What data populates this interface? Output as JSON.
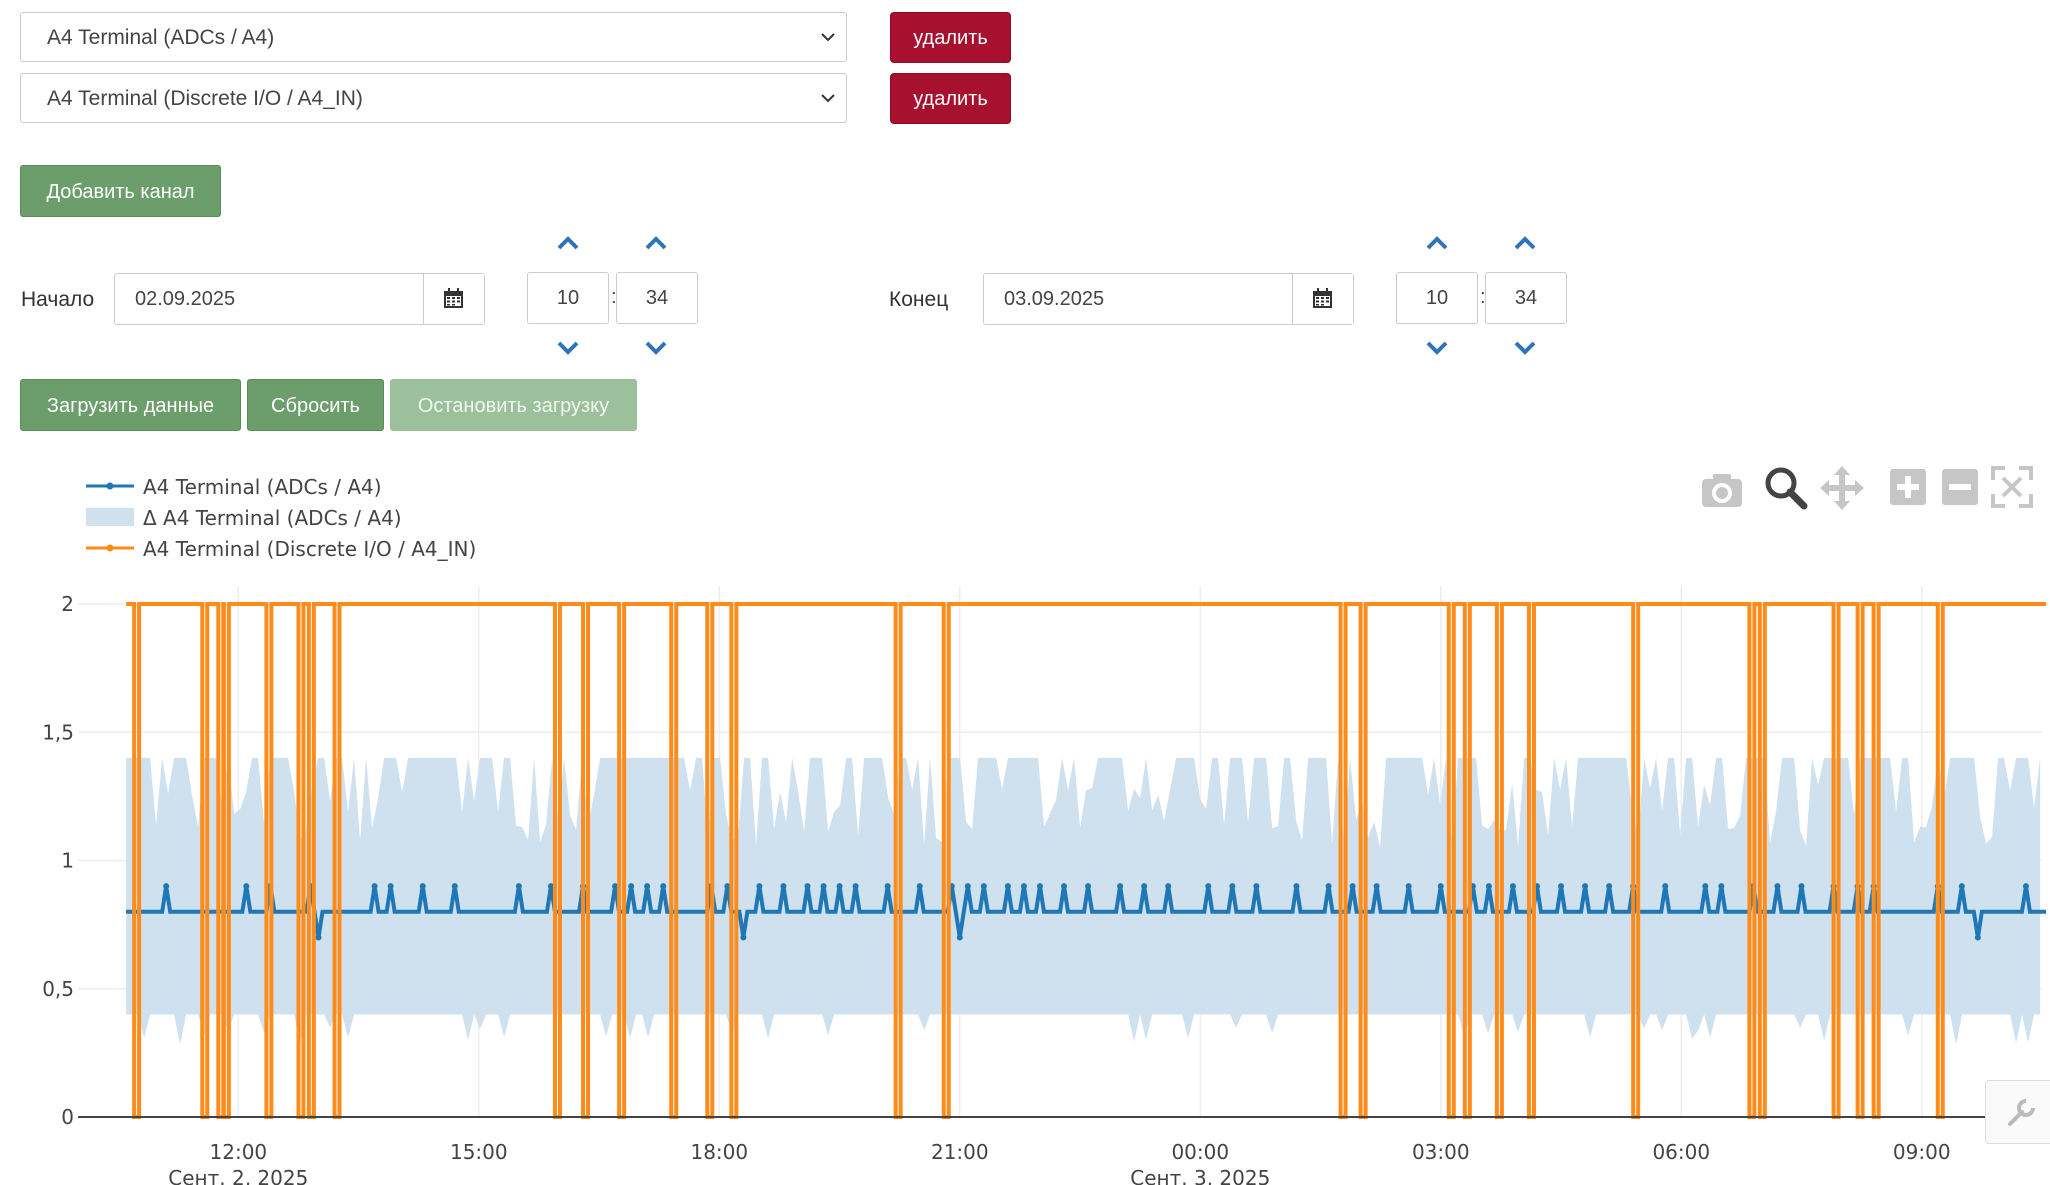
{
  "channels": [
    {
      "value": "A4 Terminal (ADCs / A4)",
      "delete_label": "удалить"
    },
    {
      "value": "A4 Terminal (Discrete I/O / A4_IN)",
      "delete_label": "удалить"
    }
  ],
  "add_channel_label": "Добавить канал",
  "start": {
    "label": "Начало",
    "date": "02.09.2025",
    "hour": "10",
    "minute": "34"
  },
  "end": {
    "label": "Конец",
    "date": "03.09.2025",
    "hour": "10",
    "minute": "34"
  },
  "time_separator": ":",
  "actions": {
    "load": "Загрузить данные",
    "reset": "Сбросить",
    "stop": "Остановить загрузку"
  },
  "modebar": [
    "camera-icon",
    "zoom-icon",
    "pan-icon",
    "zoom-in-icon",
    "zoom-out-icon",
    "autoscale-icon"
  ],
  "colors": {
    "delete": "#a8102f",
    "action": "#6b9e6b",
    "series_adc": "#1f77b4",
    "series_delta": "#cfe0ee",
    "series_discrete": "#ff8c1a"
  },
  "chart_data": {
    "type": "line",
    "legend": [
      "A4 Terminal (ADCs / A4)",
      "Δ A4 Terminal (ADCs / A4)",
      "A4 Terminal (Discrete I/O / A4_IN)"
    ],
    "legend_position": "top-left",
    "x_ticks": [
      "12:00",
      "15:00",
      "18:00",
      "21:00",
      "00:00",
      "03:00",
      "06:00",
      "09:00"
    ],
    "x_tick_dates": [
      "Сент. 2, 2025",
      "Сент. 3, 2025"
    ],
    "y_ticks": [
      "0",
      "0,5",
      "1",
      "1,5",
      "2"
    ],
    "ylim": [
      0,
      2.1
    ],
    "xlim_hours": [
      10.0,
      34.5
    ],
    "grid": true,
    "series": [
      {
        "name": "A4 Terminal (ADCs / A4)",
        "baseline": 0.8,
        "x_start_hour": 10.6,
        "x_end_hour": 34.55,
        "spikes_up": [
          11.1,
          12.1,
          12.4,
          12.9,
          13.7,
          13.9,
          14.3,
          14.7,
          15.5,
          15.9,
          16.3,
          16.7,
          16.9,
          17.1,
          17.3,
          17.9,
          18.1,
          18.5,
          18.8,
          19.1,
          19.3,
          19.5,
          19.7,
          20.1,
          20.5,
          20.9,
          21.1,
          21.3,
          21.6,
          21.8,
          22.0,
          22.3,
          22.6,
          23.0,
          23.3,
          23.6,
          24.1,
          24.4,
          24.7,
          25.2,
          25.6,
          25.9,
          26.2,
          26.6,
          27.0,
          27.4,
          27.6,
          27.9,
          28.2,
          28.5,
          28.8,
          29.1,
          29.4,
          29.8,
          30.3,
          30.5,
          30.9,
          31.2,
          31.5,
          31.9,
          32.2,
          32.4,
          33.2,
          33.5,
          34.3
        ],
        "spikes_down": [
          13.0,
          18.3,
          21.0,
          33.7
        ]
      },
      {
        "name": "Δ A4 Terminal (ADCs / A4)",
        "band_low": 0.4,
        "band_high": 1.4,
        "x_start_hour": 10.6,
        "x_end_hour": 34.55
      },
      {
        "name": "A4 Terminal (Discrete I/O / A4_IN)",
        "high": 2,
        "low": 0,
        "x_start_hour": 10.6,
        "x_end_hour": 34.55,
        "drops_to_zero_hours": [
          10.7,
          11.55,
          11.75,
          11.82,
          12.35,
          12.75,
          12.88,
          13.2,
          15.95,
          16.3,
          16.75,
          17.4,
          17.85,
          18.15,
          20.2,
          20.8,
          25.75,
          26.0,
          27.1,
          27.3,
          27.7,
          28.1,
          29.4,
          30.85,
          30.98,
          31.9,
          32.2,
          32.4,
          33.2
        ]
      }
    ]
  }
}
